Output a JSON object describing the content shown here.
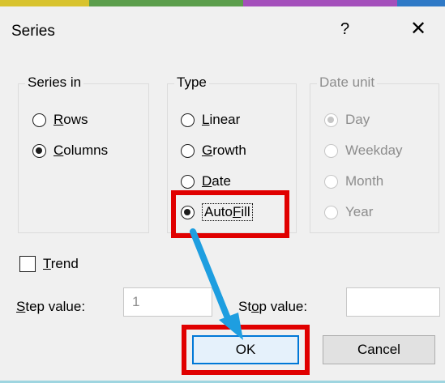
{
  "colors": {
    "top_strip": [
      "#d8c32e",
      "#5c9e4c",
      "#a44fbb",
      "#2f79c6"
    ],
    "highlight": "#e00000",
    "arrow": "#1e9ee0",
    "default_button_border": "#0078d7"
  },
  "dialog": {
    "title": "Series",
    "help_label": "?",
    "close_label": "✕"
  },
  "series_in": {
    "legend": "Series in",
    "options": [
      {
        "label": "Rows",
        "checked": false
      },
      {
        "label": "Columns",
        "checked": true
      }
    ]
  },
  "type": {
    "legend": "Type",
    "options": [
      {
        "label": "Linear",
        "checked": false
      },
      {
        "label": "Growth",
        "checked": false
      },
      {
        "label": "Date",
        "checked": false
      },
      {
        "label": "AutoFill",
        "checked": true
      }
    ]
  },
  "date_unit": {
    "legend": "Date unit",
    "disabled": true,
    "options": [
      {
        "label": "Day",
        "checked": true
      },
      {
        "label": "Weekday",
        "checked": false
      },
      {
        "label": "Month",
        "checked": false
      },
      {
        "label": "Year",
        "checked": false
      }
    ]
  },
  "trend": {
    "label": "Trend",
    "checked": false
  },
  "step_value": {
    "label": "Step value:",
    "value": "1"
  },
  "stop_value": {
    "label": "Stop value:",
    "value": ""
  },
  "buttons": {
    "ok": "OK",
    "cancel": "Cancel"
  },
  "annotations": {
    "highlight_targets": [
      "AutoFill",
      "OK"
    ],
    "arrow_from": "AutoFill",
    "arrow_to": "OK"
  }
}
